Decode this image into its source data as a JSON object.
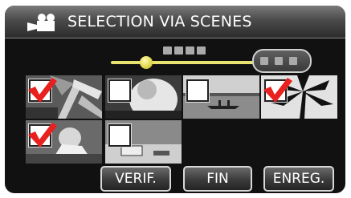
{
  "title": {
    "icon": "video-camera-icon",
    "text": "SELECTION VIA SCENES"
  },
  "scroll": {
    "position": 0.2
  },
  "thumbnails": [
    {
      "scene": "palm-fronds",
      "checked": true
    },
    {
      "scene": "portrait-in-white",
      "checked": false
    },
    {
      "scene": "lake-canoe",
      "checked": false
    },
    {
      "scene": "palm-silhouette",
      "checked": true
    },
    {
      "scene": "child-grass",
      "checked": true
    },
    {
      "scene": "beach-car",
      "checked": false
    }
  ],
  "buttons": {
    "verify": "VERIF.",
    "end": "FIN",
    "save": "ENREG."
  },
  "colors": {
    "check": "#e8201e",
    "scrollbar": "#e8e26e"
  }
}
